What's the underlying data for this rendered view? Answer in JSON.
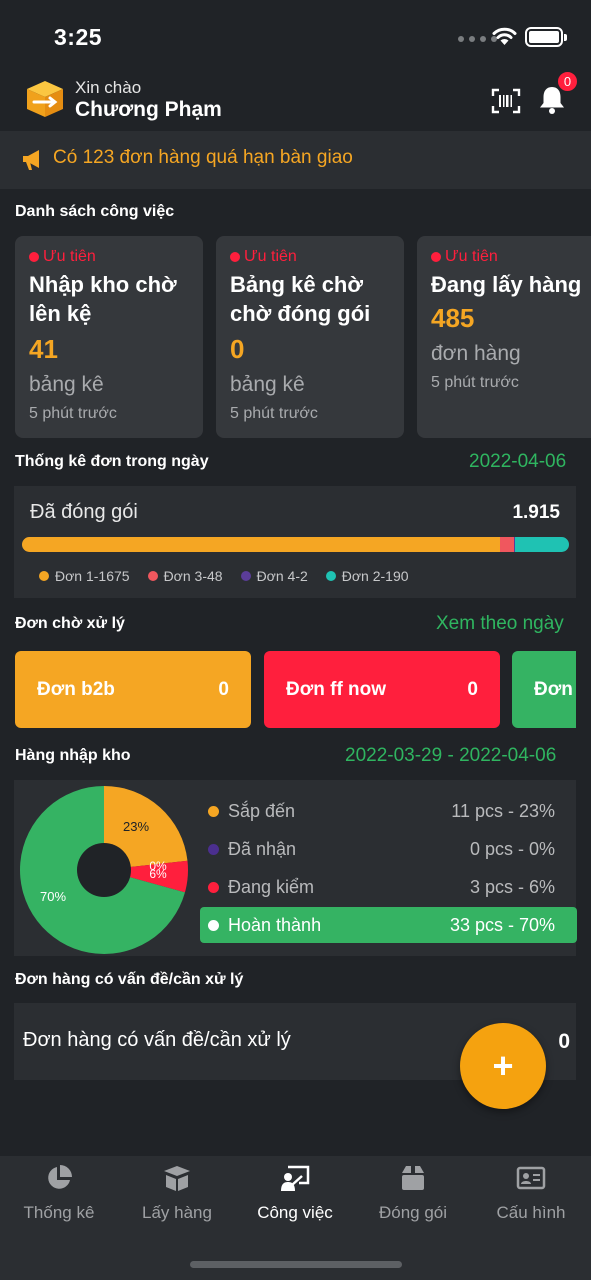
{
  "status_bar": {
    "time": "3:25"
  },
  "header": {
    "greeting": "Xin chào",
    "user_name": "Chương Phạm",
    "notification_count": "0"
  },
  "banner": {
    "text": "Có 123 đơn hàng quá hạn bàn giao"
  },
  "tasks": {
    "title": "Danh sách công việc",
    "items": [
      {
        "priority": "Ưu tiên",
        "title": "Nhập kho chờ lên kệ",
        "count": "41",
        "unit": "bảng kê",
        "time": "5 phút trước"
      },
      {
        "priority": "Ưu tiên",
        "title": "Bảng kê chờ chờ đóng gói",
        "count": "0",
        "unit": "bảng kê",
        "time": "5 phút trước"
      },
      {
        "priority": "Ưu tiên",
        "title": "Đang lấy hàng",
        "count": "485",
        "unit": "đơn hàng",
        "time": "5 phút trước"
      }
    ]
  },
  "daily_stats": {
    "title": "Thống kê đơn trong ngày",
    "date": "2022-04-06",
    "label": "Đã đóng gói",
    "total": "1.915",
    "segments": [
      {
        "label": "Đơn 1-1675",
        "value": 1675,
        "color": "#f5a623"
      },
      {
        "label": "Đơn 3-48",
        "value": 48,
        "color": "#f0575e"
      },
      {
        "label": "Đơn 4-2",
        "value": 2,
        "color": "#5b3d99"
      },
      {
        "label": "Đơn 2-190",
        "value": 190,
        "color": "#1fc2b3"
      }
    ]
  },
  "pending": {
    "title": "Đơn chờ xử lý",
    "link": "Xem theo ngày",
    "cards": [
      {
        "label": "Đơn b2b",
        "count": "0",
        "color": "#f5a623"
      },
      {
        "label": "Đơn ff now",
        "count": "0",
        "color": "#ff1f3d"
      },
      {
        "label": "Đơn",
        "count": "",
        "color": "#35b363"
      }
    ]
  },
  "warehouse": {
    "title": "Hàng nhập kho",
    "date_range": "2022-03-29 - 2022-04-06",
    "rows": [
      {
        "label": "Sắp đến",
        "value": "11 pcs - 23%",
        "color": "#f5a623",
        "pct": 23
      },
      {
        "label": "Đã nhận",
        "value": "0 pcs - 0%",
        "color": "#4b2f8f",
        "pct": 0
      },
      {
        "label": "Đang kiểm",
        "value": "3 pcs - 6%",
        "color": "#ff1f3d",
        "pct": 6
      },
      {
        "label": "Hoàn thành",
        "value": "33 pcs - 70%",
        "color": "#ffffff",
        "pct": 70
      }
    ],
    "pie_labels": {
      "arrived": "23%",
      "received": "0%",
      "checking": "6%",
      "done": "70%"
    }
  },
  "problems": {
    "title": "Đơn hàng có vấn đề/cần xử lý",
    "label": "Đơn hàng có vấn đề/cần xử lý",
    "count": "0",
    "fab": "+"
  },
  "nav": [
    {
      "label": "Thống kê",
      "icon": "pie-chart-icon"
    },
    {
      "label": "Lấy hàng",
      "icon": "box-open-icon"
    },
    {
      "label": "Công việc",
      "icon": "worker-board-icon"
    },
    {
      "label": "Đóng gói",
      "icon": "package-icon"
    },
    {
      "label": "Cấu hình",
      "icon": "id-card-icon"
    }
  ]
}
